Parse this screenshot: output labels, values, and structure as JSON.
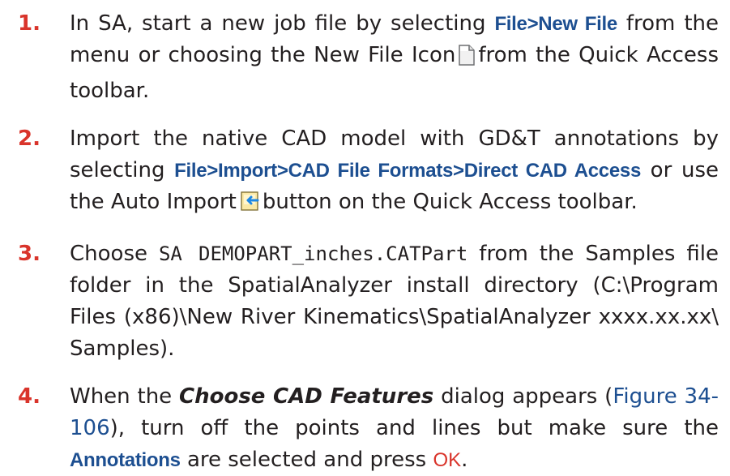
{
  "steps": [
    {
      "number": "1.",
      "t1": "In SA, start a new job file by selecting ",
      "menu": "File>New File",
      "t2": " from the menu or choosing the New File Icon",
      "icon": "new-file-icon",
      "t3": "from the Quick Access toolbar."
    },
    {
      "number": "2.",
      "t1": "Import the native CAD model with GD&T annotations by selecting ",
      "menu": "File>Import>CAD File Formats>Direct CAD Access",
      "t2": " or use the Auto Import",
      "icon": "auto-import-icon",
      "t3": "button on the Quick Access toolbar."
    },
    {
      "number": "3.",
      "t1": "Choose ",
      "filename": "SA DEMOPART_inches.CATPart",
      "t2": " from the Samples file folder in the SpatialAnalyzer install directory (C:\\Program Files (x86)\\New River Kinematics\\SpatialAnalyzer xxxx.xx.xx\\ Samples)."
    },
    {
      "number": "4.",
      "t1": "When the ",
      "dialog": "Choose CAD Features",
      "t2": " dialog appears (",
      "figref": "Figure 34-106",
      "t3": "), turn off the points and lines but make sure the ",
      "annotations": "Annotations",
      "t4": " are selected and press ",
      "ok": "OK",
      "t5": "."
    }
  ],
  "colors": {
    "step_number": "#d9342b",
    "ui_term": "#1d4f91",
    "body_text": "#231f20"
  }
}
